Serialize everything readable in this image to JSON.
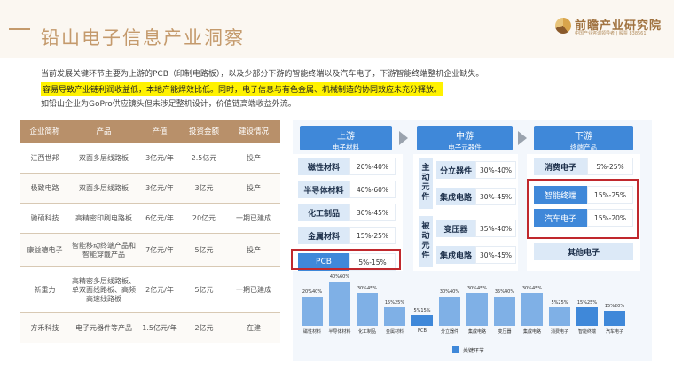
{
  "header": {
    "title": "铅山电子信息产业洞察",
    "logo_text": "前瞻产业研究院",
    "logo_sub": "中国产业咨询领导者 | 股票 838561"
  },
  "paragraphs": [
    "当前发展关键环节主要为上游的PCB（印制电路板），以及少部分下游的智能终端以及汽车电子，下游智能终端整机企业缺失。",
    "容易导致产业链利润收益低，本地产能焊效比低。同时，电子信息与有色金属、机械制造的协同效应未充分释放。",
    "如铅山企业为GoPro供应镜头但未涉足整机设计，价值链高端收益外流。"
  ],
  "table": {
    "headers": [
      "企业简称",
      "产品",
      "产值",
      "投资金额",
      "建设情况"
    ],
    "rows": [
      [
        "江西世邦",
        "双面多层线路板",
        "3亿元/年",
        "2.5亿元",
        "投产"
      ],
      [
        "极致电路",
        "双面多层线路板",
        "3亿元/年",
        "3亿元",
        "投产"
      ],
      [
        "驰硕科技",
        "高精密印刷电路板",
        "6亿元/年",
        "20亿元",
        "一期已建成"
      ],
      [
        "康益德电子",
        "智能移动终端产品和智能穿戴产品",
        "7亿元/年",
        "5亿元",
        "投产"
      ],
      [
        "新重力",
        "高精密多层线路板、单双面线路板、高频高速线路板",
        "2亿元/年",
        "5亿元",
        "一期已建成"
      ],
      [
        "方禾科技",
        "电子元器件等产品",
        "1.5亿元/年",
        "2亿元",
        "在建"
      ]
    ]
  },
  "chain": {
    "upstream": {
      "title": "上游",
      "subtitle": "电子材料",
      "items": [
        {
          "name": "磁性材料",
          "value": "20%-40%"
        },
        {
          "name": "半导体材料",
          "value": "40%-60%"
        },
        {
          "name": "化工制品",
          "value": "30%-45%"
        },
        {
          "name": "金属材料",
          "value": "15%-25%"
        },
        {
          "name": "PCB",
          "value": "5%-15%"
        }
      ]
    },
    "midstream": {
      "title": "中游",
      "subtitle": "电子元器件",
      "active_label": "主动元件",
      "passive_label": "被动元件",
      "active": [
        {
          "name": "分立器件",
          "value": "30%-40%"
        },
        {
          "name": "集成电路",
          "value": "30%-45%"
        }
      ],
      "passive": [
        {
          "name": "变压器",
          "value": "35%-40%"
        },
        {
          "name": "集成电路",
          "value": "30%-45%"
        }
      ]
    },
    "downstream": {
      "title": "下游",
      "subtitle": "终端产品",
      "items": [
        {
          "name": "消费电子",
          "value": "5%-25%"
        },
        {
          "name": "智能终端",
          "value": "15%-25%"
        },
        {
          "name": "汽车电子",
          "value": "15%-20%"
        },
        {
          "name": "其他电子",
          "value": ""
        }
      ]
    }
  },
  "chart_data": {
    "type": "bar",
    "categories": [
      "磁性材料",
      "半导体材料",
      "化工制品",
      "金属材料",
      "PCB",
      "分立器件",
      "集成电路",
      "变压器",
      "集成电路",
      "消费电子",
      "智能终端",
      "汽车电子"
    ],
    "labels": [
      "20%40%",
      "40%60%",
      "30%45%",
      "15%25%",
      "5%15%",
      "30%40%",
      "30%45%",
      "35%40%",
      "30%45%",
      "5%25%",
      "15%25%",
      "15%20%"
    ],
    "low": [
      20,
      40,
      30,
      15,
      5,
      30,
      30,
      35,
      30,
      5,
      15,
      15
    ],
    "high": [
      40,
      60,
      45,
      25,
      15,
      40,
      45,
      40,
      45,
      25,
      25,
      20
    ],
    "key": [
      false,
      false,
      false,
      false,
      true,
      false,
      false,
      false,
      false,
      false,
      true,
      true
    ],
    "legend": "关键环节",
    "colors": {
      "normal": "#7fb0e6",
      "key": "#3f88d9"
    }
  }
}
